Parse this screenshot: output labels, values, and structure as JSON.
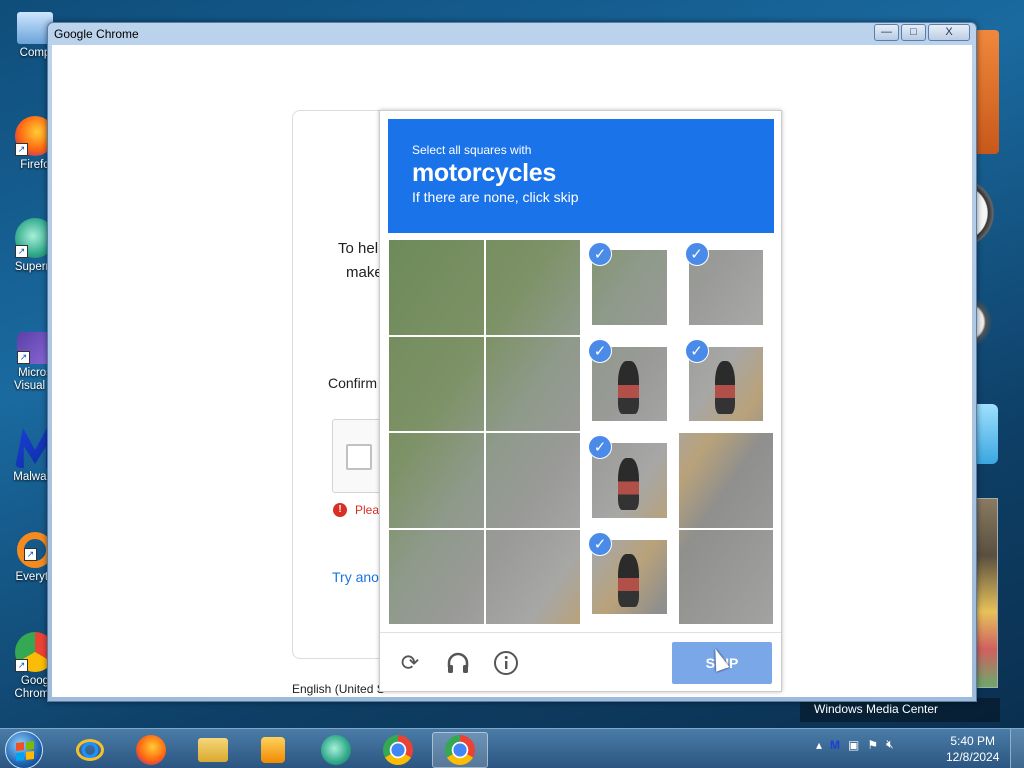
{
  "desktop": {
    "icons": [
      {
        "label": "Comp",
        "icon": "computer-icon"
      },
      {
        "label": "Firefo",
        "icon": "firefox-icon"
      },
      {
        "label": "Superm",
        "icon": "supermium-icon"
      },
      {
        "label": "Micros\nVisual S",
        "icon": "visual-studio-icon"
      },
      {
        "label": "Malware",
        "icon": "malwarebytes-icon"
      },
      {
        "label": "Everyth",
        "icon": "everything-icon"
      },
      {
        "label": "Goog\nChrome",
        "icon": "chrome-icon"
      }
    ],
    "gadget_text": "Windows Media Center"
  },
  "window": {
    "title": "Google Chrome",
    "minimize": "—",
    "maximize": "□",
    "close": "X"
  },
  "page": {
    "line1": "To hel",
    "line2": "make",
    "confirm": "Confirm",
    "error": "Pleas",
    "try_another": "Try anot",
    "language": "English (United S"
  },
  "captcha": {
    "instruction_small": "Select all squares with",
    "target": "motorcycles",
    "instruction_sub": "If there are none, click skip",
    "tiles": [
      {
        "selected": false
      },
      {
        "selected": false
      },
      {
        "selected": true
      },
      {
        "selected": true
      },
      {
        "selected": false
      },
      {
        "selected": false
      },
      {
        "selected": true
      },
      {
        "selected": true
      },
      {
        "selected": false
      },
      {
        "selected": false
      },
      {
        "selected": true
      },
      {
        "selected": false
      },
      {
        "selected": false
      },
      {
        "selected": false
      },
      {
        "selected": true
      },
      {
        "selected": false
      }
    ],
    "check_glyph": "✓",
    "reload_icon": "reload-icon",
    "audio_icon": "headphones-icon",
    "info_icon": "info-icon",
    "skip_label": "SKIP"
  },
  "taskbar": {
    "apps": [
      "internet-explorer-icon",
      "firefox-icon",
      "file-explorer-icon",
      "media-player-icon",
      "supermium-icon",
      "chrome-icon",
      "chrome-icon"
    ],
    "time": "5:40 PM",
    "date": "12/8/2024"
  }
}
